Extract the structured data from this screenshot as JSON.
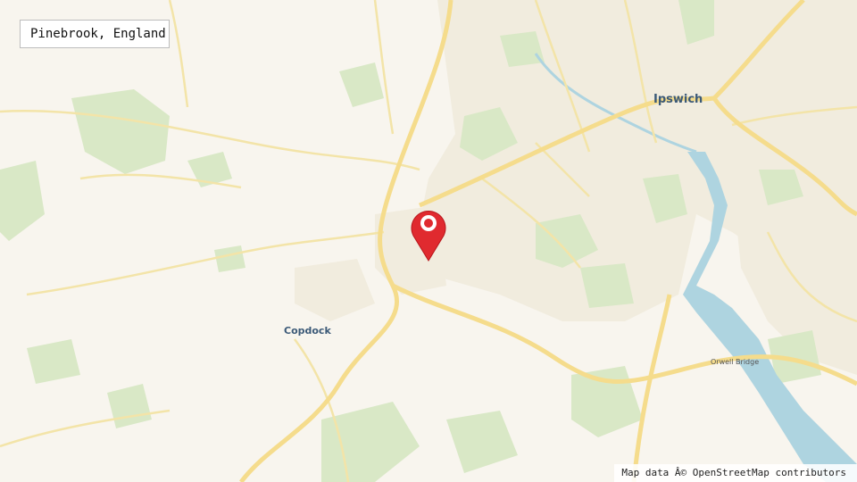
{
  "title": "Pinebrook, England",
  "places": {
    "ipswich": "Ipswich",
    "copdock": "Copdock",
    "orwell_bridge": "Orwell Bridge"
  },
  "attribution": "Map data Â© OpenStreetMap contributors",
  "marker": {
    "icon": "location-pin-icon",
    "color": "#e02a2f"
  },
  "colors": {
    "land": "#f8f5ee",
    "urban": "#f1ecde",
    "green": "#d9e8c6",
    "water": "#aed4e0",
    "major_road": "#f5dc8c",
    "minor_road": "#f8eab0"
  }
}
